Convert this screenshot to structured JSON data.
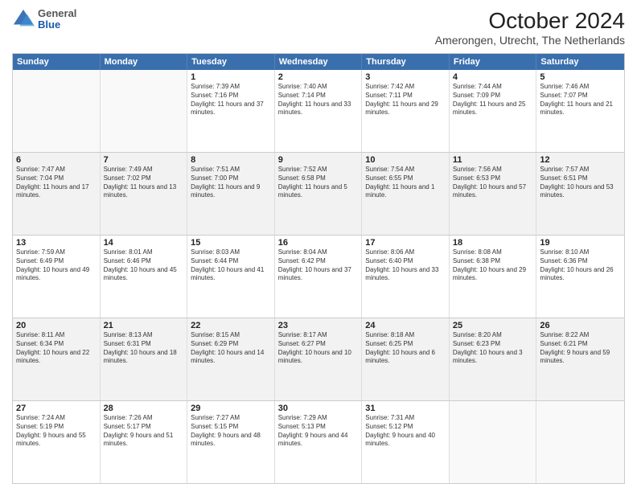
{
  "header": {
    "title": "October 2024",
    "subtitle": "Amerongen, Utrecht, The Netherlands",
    "logo_general": "General",
    "logo_blue": "Blue"
  },
  "days_of_week": [
    "Sunday",
    "Monday",
    "Tuesday",
    "Wednesday",
    "Thursday",
    "Friday",
    "Saturday"
  ],
  "weeks": [
    [
      {
        "day": "",
        "info": ""
      },
      {
        "day": "",
        "info": ""
      },
      {
        "day": "1",
        "info": "Sunrise: 7:39 AM\nSunset: 7:16 PM\nDaylight: 11 hours and 37 minutes."
      },
      {
        "day": "2",
        "info": "Sunrise: 7:40 AM\nSunset: 7:14 PM\nDaylight: 11 hours and 33 minutes."
      },
      {
        "day": "3",
        "info": "Sunrise: 7:42 AM\nSunset: 7:11 PM\nDaylight: 11 hours and 29 minutes."
      },
      {
        "day": "4",
        "info": "Sunrise: 7:44 AM\nSunset: 7:09 PM\nDaylight: 11 hours and 25 minutes."
      },
      {
        "day": "5",
        "info": "Sunrise: 7:46 AM\nSunset: 7:07 PM\nDaylight: 11 hours and 21 minutes."
      }
    ],
    [
      {
        "day": "6",
        "info": "Sunrise: 7:47 AM\nSunset: 7:04 PM\nDaylight: 11 hours and 17 minutes."
      },
      {
        "day": "7",
        "info": "Sunrise: 7:49 AM\nSunset: 7:02 PM\nDaylight: 11 hours and 13 minutes."
      },
      {
        "day": "8",
        "info": "Sunrise: 7:51 AM\nSunset: 7:00 PM\nDaylight: 11 hours and 9 minutes."
      },
      {
        "day": "9",
        "info": "Sunrise: 7:52 AM\nSunset: 6:58 PM\nDaylight: 11 hours and 5 minutes."
      },
      {
        "day": "10",
        "info": "Sunrise: 7:54 AM\nSunset: 6:55 PM\nDaylight: 11 hours and 1 minute."
      },
      {
        "day": "11",
        "info": "Sunrise: 7:56 AM\nSunset: 6:53 PM\nDaylight: 10 hours and 57 minutes."
      },
      {
        "day": "12",
        "info": "Sunrise: 7:57 AM\nSunset: 6:51 PM\nDaylight: 10 hours and 53 minutes."
      }
    ],
    [
      {
        "day": "13",
        "info": "Sunrise: 7:59 AM\nSunset: 6:49 PM\nDaylight: 10 hours and 49 minutes."
      },
      {
        "day": "14",
        "info": "Sunrise: 8:01 AM\nSunset: 6:46 PM\nDaylight: 10 hours and 45 minutes."
      },
      {
        "day": "15",
        "info": "Sunrise: 8:03 AM\nSunset: 6:44 PM\nDaylight: 10 hours and 41 minutes."
      },
      {
        "day": "16",
        "info": "Sunrise: 8:04 AM\nSunset: 6:42 PM\nDaylight: 10 hours and 37 minutes."
      },
      {
        "day": "17",
        "info": "Sunrise: 8:06 AM\nSunset: 6:40 PM\nDaylight: 10 hours and 33 minutes."
      },
      {
        "day": "18",
        "info": "Sunrise: 8:08 AM\nSunset: 6:38 PM\nDaylight: 10 hours and 29 minutes."
      },
      {
        "day": "19",
        "info": "Sunrise: 8:10 AM\nSunset: 6:36 PM\nDaylight: 10 hours and 26 minutes."
      }
    ],
    [
      {
        "day": "20",
        "info": "Sunrise: 8:11 AM\nSunset: 6:34 PM\nDaylight: 10 hours and 22 minutes."
      },
      {
        "day": "21",
        "info": "Sunrise: 8:13 AM\nSunset: 6:31 PM\nDaylight: 10 hours and 18 minutes."
      },
      {
        "day": "22",
        "info": "Sunrise: 8:15 AM\nSunset: 6:29 PM\nDaylight: 10 hours and 14 minutes."
      },
      {
        "day": "23",
        "info": "Sunrise: 8:17 AM\nSunset: 6:27 PM\nDaylight: 10 hours and 10 minutes."
      },
      {
        "day": "24",
        "info": "Sunrise: 8:18 AM\nSunset: 6:25 PM\nDaylight: 10 hours and 6 minutes."
      },
      {
        "day": "25",
        "info": "Sunrise: 8:20 AM\nSunset: 6:23 PM\nDaylight: 10 hours and 3 minutes."
      },
      {
        "day": "26",
        "info": "Sunrise: 8:22 AM\nSunset: 6:21 PM\nDaylight: 9 hours and 59 minutes."
      }
    ],
    [
      {
        "day": "27",
        "info": "Sunrise: 7:24 AM\nSunset: 5:19 PM\nDaylight: 9 hours and 55 minutes."
      },
      {
        "day": "28",
        "info": "Sunrise: 7:26 AM\nSunset: 5:17 PM\nDaylight: 9 hours and 51 minutes."
      },
      {
        "day": "29",
        "info": "Sunrise: 7:27 AM\nSunset: 5:15 PM\nDaylight: 9 hours and 48 minutes."
      },
      {
        "day": "30",
        "info": "Sunrise: 7:29 AM\nSunset: 5:13 PM\nDaylight: 9 hours and 44 minutes."
      },
      {
        "day": "31",
        "info": "Sunrise: 7:31 AM\nSunset: 5:12 PM\nDaylight: 9 hours and 40 minutes."
      },
      {
        "day": "",
        "info": ""
      },
      {
        "day": "",
        "info": ""
      }
    ]
  ]
}
